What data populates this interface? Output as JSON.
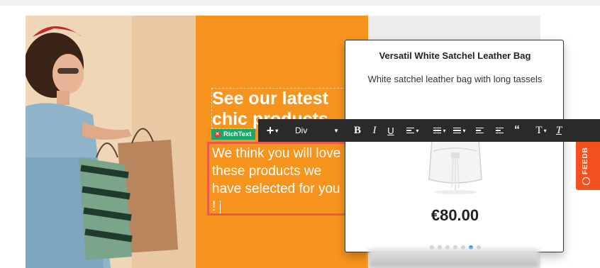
{
  "hero": {
    "headline_line1": "See our latest",
    "headline_line2": "chic products",
    "body_text": "We think you will love these products we have selected for you !"
  },
  "component_badge": {
    "label": "RichText",
    "remove_icon": "close-icon"
  },
  "toolbar": {
    "add_icon": "plus-icon",
    "block_type": "Div",
    "bold": "B",
    "italic": "I",
    "underline": "U",
    "blockquote": "“",
    "text_style": "T",
    "clear_format": "T"
  },
  "product_card": {
    "title": "Versatil White Satchel Leather Bag",
    "subtitle": "White satchel leather bag with long tassels",
    "price": "€80.00",
    "carousel_dots": 7,
    "active_dot": 5
  },
  "feedback_tab": {
    "label": "FEEDB",
    "icon": "chat-icon"
  },
  "colors": {
    "accent_orange": "#f7941d",
    "selection_red": "#e85d4a",
    "badge_green": "#19a86b",
    "feedback_orange": "#f4511e"
  }
}
